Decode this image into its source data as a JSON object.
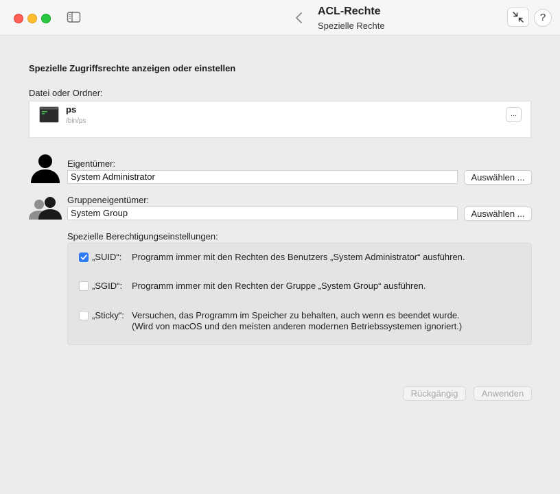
{
  "titlebar": {
    "title": "ACL-Rechte",
    "subtitle": "Spezielle Rechte",
    "help_label": "?"
  },
  "heading": "Spezielle Zugriffsrechte anzeigen oder einstellen",
  "file": {
    "label": "Datei oder Ordner:",
    "name": "ps",
    "path": "/bin/ps",
    "more_label": "..."
  },
  "owner": {
    "label": "Eigentümer:",
    "value": "System Administrator",
    "select_label": "Auswählen ..."
  },
  "group": {
    "label": "Gruppeneigentümer:",
    "value": "System Group",
    "select_label": "Auswählen ..."
  },
  "special": {
    "label": "Spezielle Berechtigungseinstellungen:",
    "items": [
      {
        "label": "„SUID“:",
        "checked": true,
        "description": "Programm immer mit den Rechten des Benutzers „System Administrator“ ausführen."
      },
      {
        "label": "„SGID“:",
        "checked": false,
        "description": "Programm immer mit den Rechten der Gruppe „System Group“ ausführen."
      },
      {
        "label": "„Sticky“:",
        "checked": false,
        "description": "Versuchen, das Programm im Speicher zu behalten, auch wenn es beendet wurde.",
        "description2": "(Wird von macOS und den meisten anderen modernen Betriebssystemen ignoriert.)"
      }
    ]
  },
  "actions": {
    "undo_label": "Rückgängig",
    "apply_label": "Anwenden"
  },
  "colors": {
    "accent": "#2f7bf5",
    "close": "#fe5f57",
    "minimize": "#febc2e",
    "maximize": "#28c840"
  },
  "icons": [
    "sidebar-toggle-icon",
    "chevron-left-icon",
    "collapse-arrows-icon",
    "help-icon",
    "terminal-icon",
    "person-icon",
    "group-icon",
    "checkmark-icon"
  ]
}
